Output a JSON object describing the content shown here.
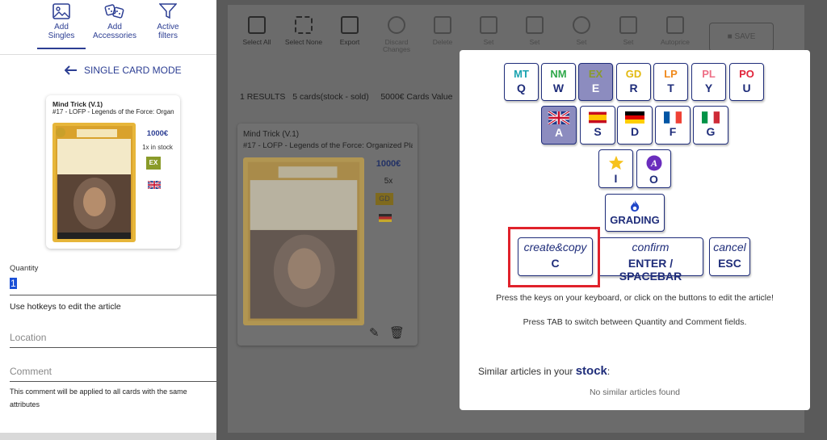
{
  "tabs": [
    {
      "line1": "Add",
      "line2": "Singles"
    },
    {
      "line1": "Add",
      "line2": "Accessories"
    },
    {
      "line1": "Active",
      "line2": "filters"
    }
  ],
  "mode_label": "SINGLE CARD MODE",
  "card_preview": {
    "title": "Mind Trick (V.1)",
    "subtitle": "#17  - LOFP - Legends of the Force: Organized Play",
    "price": "1000€",
    "stock": "1x in stock",
    "condition": "EX",
    "condition_color": "#8a9b2a"
  },
  "form": {
    "quantity_label": "Quantity",
    "quantity_value": "1",
    "hint": "Use hotkeys to edit the article",
    "location_placeholder": "Location",
    "comment_placeholder": "Comment",
    "comment_note": "This comment will be applied to all cards with the same attributes"
  },
  "toolbar": [
    {
      "label": "Select All",
      "icon": "select-all-icon",
      "dim": false
    },
    {
      "label": "Select None",
      "icon": "select-none-icon",
      "dim": false
    },
    {
      "label": "Export",
      "icon": "export-icon",
      "dim": false
    },
    {
      "label": "Discard Changes",
      "icon": "undo-icon",
      "dim": true
    },
    {
      "label": "Delete",
      "icon": "trash-icon",
      "dim": true
    },
    {
      "label": "Set",
      "icon": "tag-icon",
      "dim": true
    },
    {
      "label": "Set",
      "icon": "hierarchy-icon",
      "dim": true
    },
    {
      "label": "Set",
      "icon": "compass-icon",
      "dim": true
    },
    {
      "label": "Set",
      "icon": "comment-icon",
      "dim": true
    },
    {
      "label": "Autoprice",
      "icon": "autoprice-icon",
      "dim": true
    }
  ],
  "save_label": "SAVE",
  "results": {
    "count": "1 RESULTS",
    "cards": "5 cards(stock - sold)",
    "value": "5000€ Cards Value"
  },
  "article_card": {
    "title": "Mind Trick (V.1)",
    "subtitle": "#17  - LOFP - Legends of the Force: Organized Play",
    "price": "1000€",
    "qty": "5x",
    "condition": "GD"
  },
  "conditions": [
    {
      "code": "MT",
      "key": "Q",
      "color": "#1aa3b0",
      "selected": false
    },
    {
      "code": "NM",
      "key": "W",
      "color": "#2fa84a",
      "selected": false
    },
    {
      "code": "EX",
      "key": "E",
      "color": "#8a9b2a",
      "selected": true
    },
    {
      "code": "GD",
      "key": "R",
      "color": "#e2b90f",
      "selected": false
    },
    {
      "code": "LP",
      "key": "T",
      "color": "#f08a1c",
      "selected": false
    },
    {
      "code": "PL",
      "key": "Y",
      "color": "#ee6f86",
      "selected": false
    },
    {
      "code": "PO",
      "key": "U",
      "color": "#e1253b",
      "selected": false
    }
  ],
  "languages": [
    {
      "flag": "uk-flag-icon",
      "key": "A",
      "selected": true
    },
    {
      "flag": "spain-flag-icon",
      "key": "S",
      "selected": false
    },
    {
      "flag": "germany-flag-icon",
      "key": "D",
      "selected": false
    },
    {
      "flag": "france-flag-icon",
      "key": "F",
      "selected": false
    },
    {
      "flag": "italy-flag-icon",
      "key": "G",
      "selected": false
    }
  ],
  "specials": [
    {
      "icon": "star-icon",
      "key": "I"
    },
    {
      "icon": "altered-art-icon",
      "key": "O"
    }
  ],
  "grading": {
    "icon": "grading-icon",
    "label": "GRADING"
  },
  "actions": [
    {
      "name": "create&copy",
      "key": "C"
    },
    {
      "name": "confirm",
      "key": "ENTER / SPACEBAR"
    },
    {
      "name": "cancel",
      "key": "ESC"
    }
  ],
  "instructions": [
    "Press the keys on your keyboard, or click on the buttons to edit the article!",
    "Press TAB to switch between Quantity and Comment fields."
  ],
  "similar": {
    "prefix": "Similar articles in your",
    "bold": "stock",
    "suffix": ":",
    "empty": "No similar articles found"
  }
}
